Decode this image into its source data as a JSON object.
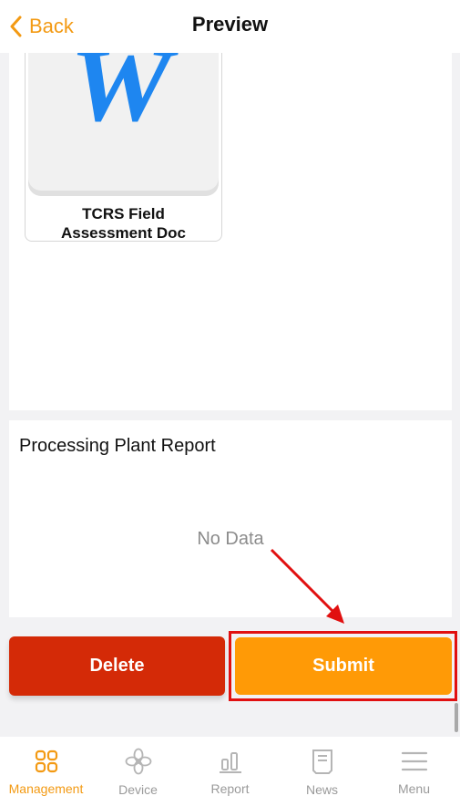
{
  "nav": {
    "back_label": "Back",
    "title": "Preview"
  },
  "attachment": {
    "doc_name": "TCRS Field Assessment Doc",
    "thumb_glyph": "W"
  },
  "report": {
    "title": "Processing Plant Report",
    "empty_text": "No Data"
  },
  "actions": {
    "delete_label": "Delete",
    "submit_label": "Submit"
  },
  "tabs": [
    {
      "label": "Management",
      "icon": "grid-icon",
      "active": true
    },
    {
      "label": "Device",
      "icon": "fan-icon",
      "active": false
    },
    {
      "label": "Report",
      "icon": "bar-chart-icon",
      "active": false
    },
    {
      "label": "News",
      "icon": "news-icon",
      "active": false
    },
    {
      "label": "Menu",
      "icon": "menu-icon",
      "active": false
    }
  ],
  "colors": {
    "accent": "#f39a13",
    "delete": "#d42a07",
    "submit": "#ff9a06",
    "annotation": "#e11010"
  }
}
